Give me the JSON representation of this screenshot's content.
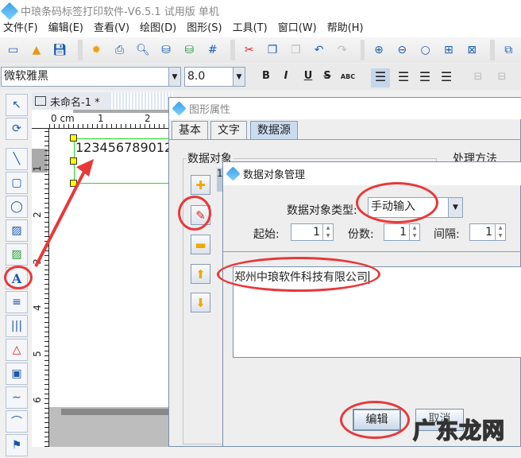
{
  "window": {
    "title": "中琅条码标签打印软件-V6.5.1 试用版 单机"
  },
  "menu": [
    "文件(F)",
    "编辑(E)",
    "查看(V)",
    "绘图(D)",
    "图形(S)",
    "工具(T)",
    "窗口(W)",
    "帮助(H)"
  ],
  "toolbar_icons": [
    "new-icon",
    "open-icon",
    "save-icon",
    "settings-icon",
    "print-icon",
    "print-preview-icon",
    "database-icon",
    "database-connect-icon",
    "grid-icon",
    "cut-icon",
    "copy-icon",
    "paste-icon",
    "undo-icon",
    "redo-icon",
    "zoom-in-icon",
    "zoom-out-icon",
    "zoom-fit-icon",
    "fit-page-icon",
    "fit-width-icon",
    "group-icon"
  ],
  "format": {
    "font": "微软雅黑",
    "size": "8.0",
    "bold": "B",
    "italic": "I",
    "underline": "U",
    "strike": "S",
    "spacing": "ABC"
  },
  "left_tools": [
    "select-tool",
    "rotate-tool",
    "line-tool",
    "rect-tool",
    "ellipse-tool",
    "image-tool",
    "image-edit-tool",
    "text-tool",
    "richtext-tool",
    "barcode-tool",
    "shape-tool",
    "qrcode-tool",
    "curve-tool",
    "arc-tool",
    "flag-tool"
  ],
  "document": {
    "tab": "未命名-1 *",
    "ruler_unit": "0 cm",
    "ruler_top": [
      "1",
      "2"
    ],
    "ruler_left": [
      "1",
      "2",
      "3",
      "4",
      "5",
      "6"
    ],
    "text_object": "123456789012"
  },
  "props_dialog": {
    "title": "图形属性",
    "tabs": [
      "基本",
      "文字",
      "数据源"
    ],
    "active_tab": "数据源",
    "group_data_objects": "数据对象",
    "group_processing": "处理方法",
    "list_first": "1"
  },
  "data_dialog": {
    "title": "数据对象管理",
    "type_label": "数据对象类型:",
    "type_value": "手动输入",
    "start_label": "起始:",
    "start_value": "1",
    "copies_label": "份数:",
    "copies_value": "1",
    "interval_label": "间隔:",
    "interval_value": "1",
    "content": "郑州中琅软件科技有限公司",
    "edit_button": "编辑",
    "cancel_button": "取消"
  },
  "watermark": "广东龙网",
  "annotation_color": "#e8383a"
}
